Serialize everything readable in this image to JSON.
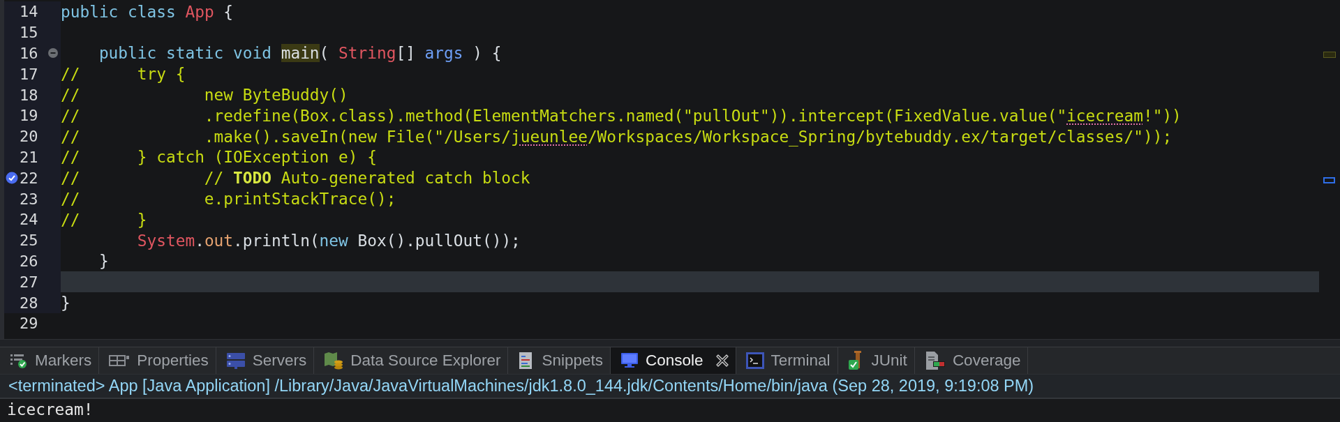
{
  "editor": {
    "lines": [
      {
        "number": "14",
        "kind": "code",
        "current": false,
        "tokens": [
          {
            "kind": "keyword",
            "text": "public class "
          },
          {
            "kind": "type",
            "text": "App"
          },
          {
            "kind": "plain",
            "text": " {"
          }
        ]
      },
      {
        "number": "15",
        "kind": "code",
        "current": false
      },
      {
        "number": "16",
        "kind": "fold",
        "current": false,
        "tokens": [
          {
            "kind": "keyword",
            "text": "    public static void "
          },
          {
            "kind": "method-decl",
            "text": "main"
          },
          {
            "kind": "plain",
            "text": "( "
          },
          {
            "kind": "type",
            "text": "String"
          },
          {
            "kind": "plain",
            "text": "[] "
          },
          {
            "kind": "param",
            "text": "args"
          },
          {
            "kind": "plain",
            "text": " ) {"
          }
        ]
      },
      {
        "number": "17",
        "kind": "code",
        "current": false,
        "tokens": [
          {
            "kind": "comment",
            "text": "//      try {"
          }
        ]
      },
      {
        "number": "18",
        "kind": "code",
        "current": false,
        "tokens": [
          {
            "kind": "comment",
            "text": "//             new ByteBuddy()"
          }
        ]
      },
      {
        "number": "19",
        "kind": "code",
        "current": false,
        "tokens": [
          {
            "kind": "comment",
            "text": "//             .redefine(Box.class).method(ElementMatchers.named(\"pullOut\")).intercept(FixedValue.value(\""
          },
          {
            "kind": "misspelled",
            "text": "icecream"
          },
          {
            "kind": "comment",
            "text": "!\"))"
          }
        ]
      },
      {
        "number": "20",
        "kind": "code",
        "current": false,
        "tokens": [
          {
            "kind": "comment",
            "text": "//             .make().saveIn(new File(\"/Users/"
          },
          {
            "kind": "misspelled",
            "text": "jueunlee"
          },
          {
            "kind": "comment",
            "text": "/Workspaces/Workspace_Spring/bytebuddy.ex/target/classes/\"));"
          }
        ]
      },
      {
        "number": "21",
        "kind": "code",
        "current": false,
        "tokens": [
          {
            "kind": "comment",
            "text": "//      } catch (IOException e) {"
          }
        ]
      },
      {
        "number": "22",
        "kind": "task",
        "current": false,
        "tokens": [
          {
            "kind": "comment",
            "text": "//             // "
          },
          {
            "kind": "task-tag",
            "text": "TODO"
          },
          {
            "kind": "comment",
            "text": " Auto-generated catch block"
          }
        ]
      },
      {
        "number": "23",
        "kind": "code",
        "current": false,
        "tokens": [
          {
            "kind": "comment",
            "text": "//             e.printStackTrace();"
          }
        ]
      },
      {
        "number": "24",
        "kind": "code",
        "current": false,
        "tokens": [
          {
            "kind": "comment",
            "text": "//      }"
          }
        ]
      },
      {
        "number": "25",
        "kind": "code",
        "current": false,
        "tokens": [
          {
            "kind": "type",
            "text": "        System"
          },
          {
            "kind": "plain",
            "text": "."
          },
          {
            "kind": "field",
            "text": "out"
          },
          {
            "kind": "plain",
            "text": ".println("
          },
          {
            "kind": "keyword",
            "text": "new"
          },
          {
            "kind": "plain",
            "text": " Box().pullOut());"
          }
        ]
      },
      {
        "number": "26",
        "kind": "code",
        "current": false,
        "tokens": [
          {
            "kind": "plain",
            "text": "    }"
          }
        ]
      },
      {
        "number": "27",
        "kind": "code",
        "current": true
      },
      {
        "number": "28",
        "kind": "code",
        "current": false,
        "tokens": [
          {
            "kind": "plain",
            "text": "}"
          }
        ]
      },
      {
        "number": "29",
        "kind": "code",
        "current": false
      }
    ]
  },
  "panel": {
    "tabs": [
      {
        "label": "Markers",
        "selected": false
      },
      {
        "label": "Properties",
        "selected": false
      },
      {
        "label": "Servers",
        "selected": false
      },
      {
        "label": "Data Source Explorer",
        "selected": false
      },
      {
        "label": "Snippets",
        "selected": false
      },
      {
        "label": "Console",
        "selected": true
      },
      {
        "label": "Terminal",
        "selected": false
      },
      {
        "label": "JUnit",
        "selected": false
      },
      {
        "label": "Coverage",
        "selected": false
      }
    ],
    "console": {
      "header": "<terminated> App [Java Application] /Library/Java/JavaVirtualMachines/jdk1.8.0_144.jdk/Contents/Home/bin/java (Sep 28, 2019, 9:19:08 PM)",
      "output": [
        "icecream!"
      ]
    }
  }
}
